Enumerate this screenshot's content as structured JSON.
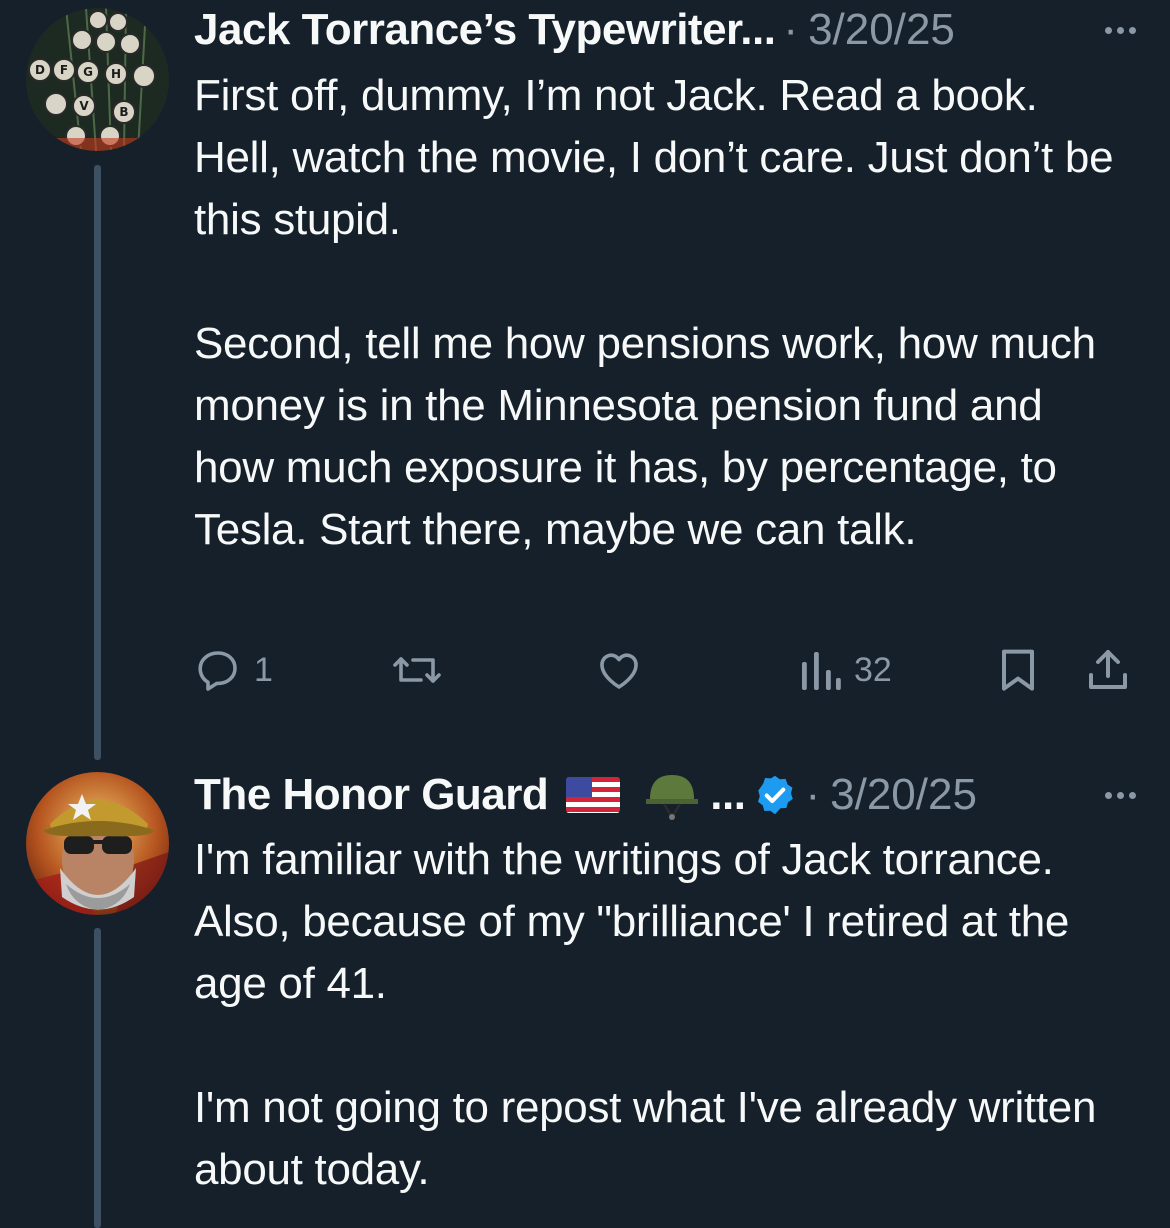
{
  "posts": [
    {
      "author": "Jack Torrance’s Typewriter...",
      "separator": "·",
      "date": "3/20/25",
      "avatar": "typewriter-keys-avatar",
      "paragraphs": [
        "First off, dummy, I’m not Jack. Read a book. Hell, watch the movie, I don’t care. Just don’t be this stupid.",
        "Second, tell me how pensions work, how much money is in the Minnesota pension fund and how much exposure it has, by percentage, to Tesla. Start there, maybe we can talk."
      ],
      "actions": {
        "reply_count": "1",
        "repost_count": "",
        "like_count": "",
        "view_count": "32"
      }
    },
    {
      "author": "The Honor Guard",
      "author_suffix": "...",
      "separator": "·",
      "date": "3/20/25",
      "avatar": "man-in-cap-avatar",
      "badges": [
        "us-flag-icon",
        "military-helmet-icon",
        "verified-badge-icon"
      ],
      "paragraphs": [
        "I'm familiar with the writings of Jack torrance. Also, because of my \"brilliance' I retired at the age of 41.",
        "I'm not going to repost what I've already written about today."
      ]
    }
  ],
  "colors": {
    "background": "#15202b",
    "text": "#f7f9f9",
    "muted": "#8b98a5",
    "thread_line": "#3d5062",
    "verified": "#1d9bf0"
  }
}
